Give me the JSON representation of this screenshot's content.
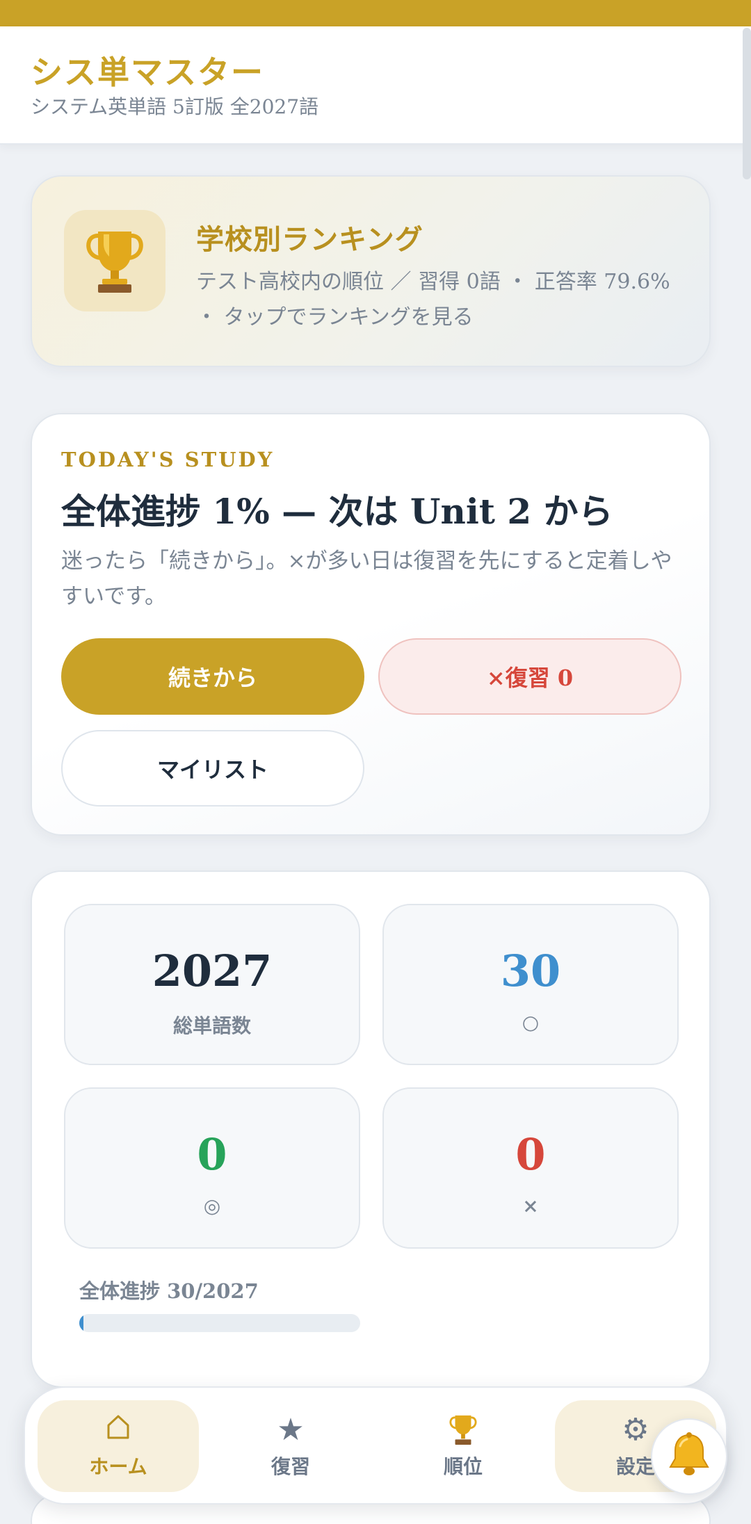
{
  "header": {
    "title": "シス単マスター",
    "subtitle": "システム英単語 5訂版 全2027語"
  },
  "ranking": {
    "icon": "trophy-icon",
    "title": "学校別ランキング",
    "description": "テスト高校内の順位 ／ 習得 0語 ・ 正答率 79.6% ・ タップでランキングを見る"
  },
  "study": {
    "eyebrow": "TODAY'S STUDY",
    "heading": "全体進捗 1% — 次は Unit 2 から",
    "hint": "迷ったら「続きから」。×が多い日は復習を先にすると定着しやすいです。",
    "continue_label": "続きから",
    "review_label": "×復習 0",
    "mylist_label": "マイリスト"
  },
  "stats": {
    "total": {
      "value": "2027",
      "label": "総単語数",
      "color": "#1f2d3d"
    },
    "circle": {
      "value": "30",
      "label": "○",
      "color": "#3f8fce"
    },
    "double_circle": {
      "value": "0",
      "label": "◎",
      "color": "#27a35a"
    },
    "cross": {
      "value": "0",
      "label": "×",
      "color": "#d6473b"
    },
    "progress_label": "全体進捗 30/2027",
    "progress_fraction": 0.0148
  },
  "nav": {
    "home": {
      "icon": "home-icon",
      "label": "ホーム"
    },
    "review": {
      "icon": "star-icon",
      "label": "復習"
    },
    "ranking": {
      "icon": "trophy-icon",
      "label": "順位"
    },
    "settings": {
      "icon": "gear-icon",
      "label": "設定"
    }
  },
  "fab": {
    "icon": "bell-icon"
  },
  "colors": {
    "accent": "#c9a227",
    "accent_dark": "#b8901f",
    "danger": "#d6473b",
    "success": "#27a35a",
    "info": "#3f8fce"
  }
}
